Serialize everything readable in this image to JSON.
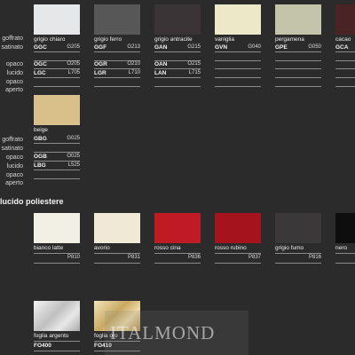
{
  "finish_labels": [
    "goffrato",
    "satinato",
    "opaco",
    "lucido",
    "opaco aperto"
  ],
  "row1": [
    {
      "name": "grigio chiaro",
      "color": "#e6e7e8",
      "rows": [
        [
          "GGC",
          "G205"
        ],
        [
          "",
          ""
        ],
        [
          "OGC",
          "O205"
        ],
        [
          "LGC",
          "L705"
        ],
        [
          "",
          ""
        ]
      ]
    },
    {
      "name": "grigio ferro",
      "color": "#575757",
      "rows": [
        [
          "GGF",
          "G213"
        ],
        [
          "",
          ""
        ],
        [
          "OGR",
          "O210"
        ],
        [
          "LGR",
          "L710"
        ],
        [
          "",
          ""
        ]
      ]
    },
    {
      "name": "grigio antracite",
      "color": "#3a3437",
      "rows": [
        [
          "GAN",
          "G215"
        ],
        [
          "",
          ""
        ],
        [
          "OAN",
          "O215"
        ],
        [
          "LAN",
          "L715"
        ],
        [
          "",
          ""
        ]
      ]
    },
    {
      "name": "vaniglia",
      "color": "#ece8c8",
      "rows": [
        [
          "GVN",
          "G040"
        ],
        [
          "",
          ""
        ],
        [
          "",
          ""
        ],
        [
          "",
          ""
        ],
        [
          "",
          ""
        ]
      ]
    },
    {
      "name": "pergamena",
      "color": "#c3c4aa",
      "rows": [
        [
          "GPE",
          "G050"
        ],
        [
          "",
          ""
        ],
        [
          "",
          ""
        ],
        [
          "",
          ""
        ],
        [
          "",
          ""
        ]
      ]
    },
    {
      "name": "cacao",
      "color": "#4a2424",
      "rows": [
        [
          "GCA",
          ""
        ],
        [
          "",
          ""
        ],
        [
          "",
          ""
        ],
        [
          "",
          ""
        ],
        [
          "",
          ""
        ]
      ]
    }
  ],
  "row2": [
    {
      "name": "beige",
      "color": "#d9c08a",
      "rows": [
        [
          "GBG",
          "G025"
        ],
        [
          "",
          ""
        ],
        [
          "OGB",
          "O025"
        ],
        [
          "LBG",
          "L525"
        ],
        [
          "",
          ""
        ]
      ]
    }
  ],
  "section_title": "lucido poliestere",
  "row3": [
    {
      "name": "bianco latte",
      "color": "#f2f0e4",
      "code": "P810"
    },
    {
      "name": "avorio",
      "color": "#f0e9d6",
      "code": "P831"
    },
    {
      "name": "rosso cina",
      "color": "#c01a25",
      "code": "P836"
    },
    {
      "name": "rosso rubino",
      "color": "#a5131d",
      "code": "P837"
    },
    {
      "name": "grigio fumo",
      "color": "#3a3839",
      "code": "P816"
    },
    {
      "name": "nero",
      "color": "#0e0e0e",
      "code": ""
    }
  ],
  "row4": [
    {
      "name": "foglia argento",
      "code": "FO400",
      "gradient": "linear-gradient(135deg,#f4f4f4 0%,#bfbfbf 45%,#e9e9e9 70%,#a9a9a9 100%)"
    },
    {
      "name": "foglia oro",
      "code": "FO410",
      "gradient": "linear-gradient(135deg,#f3e3b8 0%,#c9a962 45%,#eedcaa 70%,#b8964f 100%)"
    }
  ],
  "watermark": "ITALMOND"
}
